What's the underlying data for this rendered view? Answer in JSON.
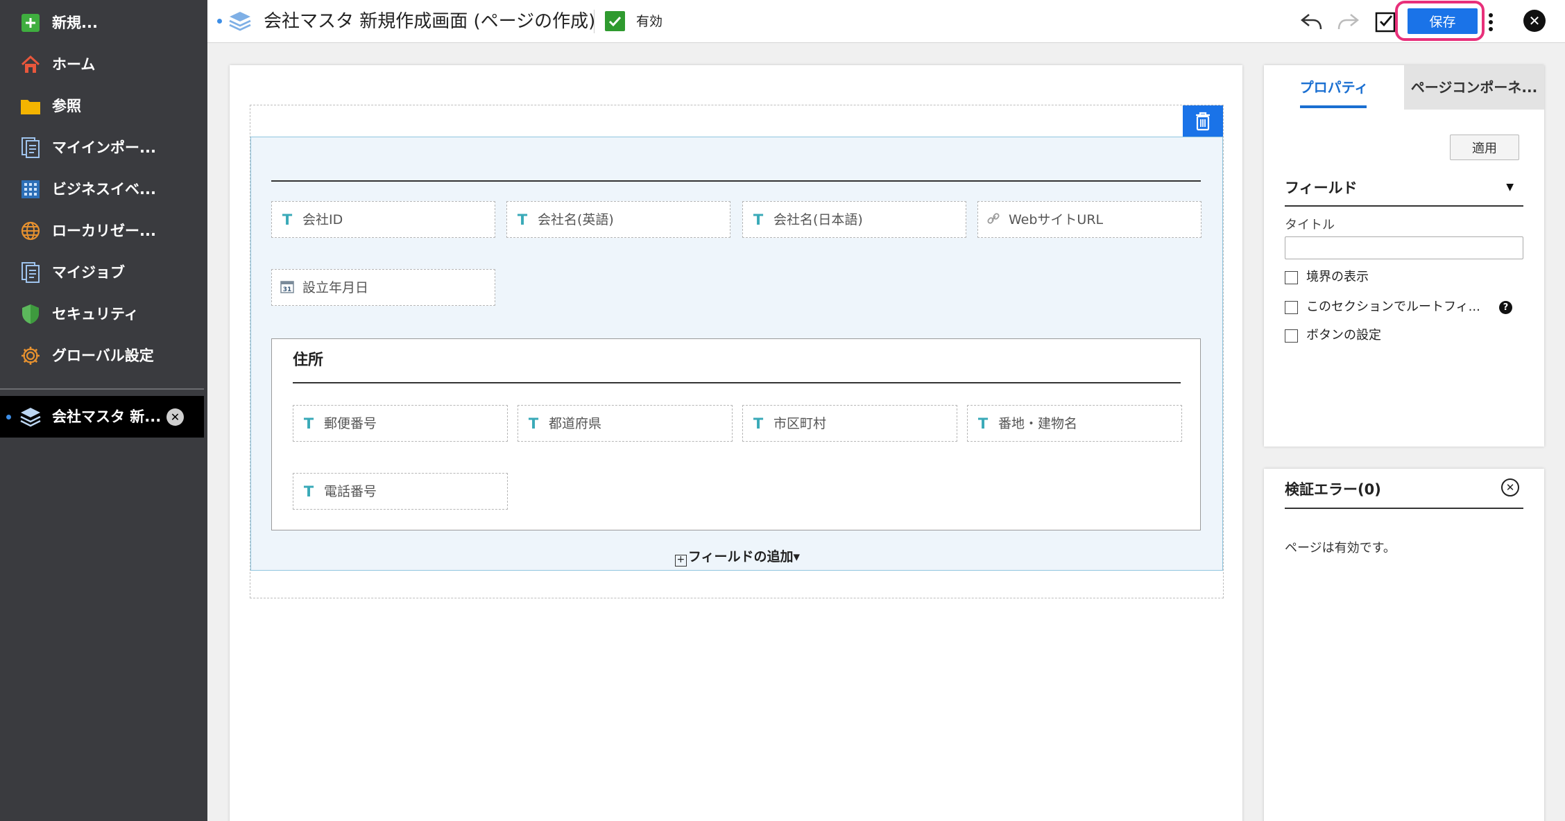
{
  "sidebar": {
    "items": [
      {
        "label": "新規...",
        "icon": "plus-icon"
      },
      {
        "label": "ホーム",
        "icon": "home-icon"
      },
      {
        "label": "参照",
        "icon": "folder-icon"
      },
      {
        "label": "マイインポー...",
        "icon": "document-icon"
      },
      {
        "label": "ビジネスイベ...",
        "icon": "grid-icon"
      },
      {
        "label": "ローカリゼー...",
        "icon": "globe-icon"
      },
      {
        "label": "マイジョブ",
        "icon": "document-icon"
      },
      {
        "label": "セキュリティ",
        "icon": "shield-icon"
      },
      {
        "label": "グローバル設定",
        "icon": "gear-icon"
      }
    ],
    "open_tab": {
      "label": "会社マスタ 新...",
      "icon": "layers-icon"
    }
  },
  "header": {
    "title": "会社マスタ 新規作成画面 (ページの作成)",
    "valid_label": "有効",
    "save_label": "保存"
  },
  "canvas": {
    "fields_row1": [
      "会社ID",
      "会社名(英語)",
      "会社名(日本語)",
      "WebサイトURL"
    ],
    "fields_row2": [
      "設立年月日"
    ],
    "address": {
      "title": "住所",
      "fields_row1": [
        "郵便番号",
        "都道府県",
        "市区町村",
        "番地・建物名"
      ],
      "fields_row2": [
        "電話番号"
      ]
    },
    "add_field_label": "フィールドの追加"
  },
  "properties": {
    "tabs": [
      "プロパティ",
      "ページコンポーネ..."
    ],
    "apply_label": "適用",
    "field_header": "フィールド",
    "title_label": "タイトル",
    "title_value": "",
    "checkboxes": [
      "境界の表示",
      "このセクションでルートフィ...",
      "ボタンの設定"
    ]
  },
  "validation": {
    "title": "検証エラー(0)",
    "message": "ページは有効です。"
  },
  "colors": {
    "accent": "#1a73e8",
    "highlight": "#e8307a",
    "sidebar_bg": "#3a3b3f",
    "valid_green": "#2f9a2f",
    "section_bg": "#eef5fb"
  }
}
